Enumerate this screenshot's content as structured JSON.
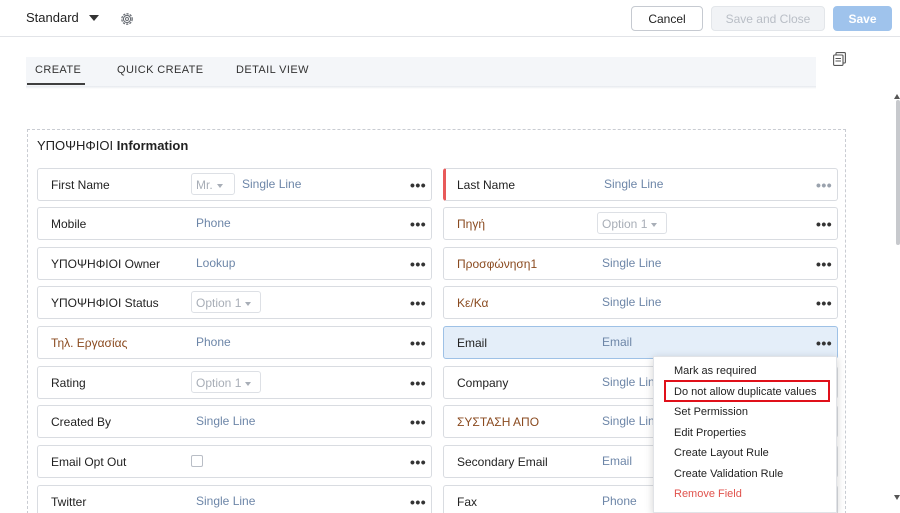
{
  "header": {
    "layout_name": "Standard",
    "cancel_label": "Cancel",
    "save_and_close_label": "Save and Close",
    "save_label": "Save"
  },
  "tabs": [
    {
      "label": "CREATE",
      "active": true
    },
    {
      "label": "QUICK CREATE",
      "active": false
    },
    {
      "label": "DETAIL VIEW",
      "active": false
    }
  ],
  "section": {
    "title_prefix": "ΥΠΟΨΗΦΙΟΙ",
    "title_suffix": "Information"
  },
  "fields_left": [
    {
      "label": "First Name",
      "type": "Single Line",
      "salutation": "Mr."
    },
    {
      "label": "Mobile",
      "type": "Phone"
    },
    {
      "label": "ΥΠΟΨΗΦΙΟΙ Owner",
      "type": "Lookup"
    },
    {
      "label": "ΥΠΟΨΗΦΙΟΙ Status",
      "type": "Option 1"
    },
    {
      "label": "Τηλ. Εργασίας",
      "type": "Phone"
    },
    {
      "label": "Rating",
      "type": "Option 1"
    },
    {
      "label": "Created By",
      "type": "Single Line"
    },
    {
      "label": "Email Opt Out",
      "type": ""
    },
    {
      "label": "Twitter",
      "type": "Single Line"
    }
  ],
  "fields_right": [
    {
      "label": "Last Name",
      "type": "Single Line"
    },
    {
      "label": "Πηγή",
      "type": "Option 1"
    },
    {
      "label": "Προσφώνηση1",
      "type": "Single Line"
    },
    {
      "label": "Κε/Κα",
      "type": "Single Line"
    },
    {
      "label": "Email",
      "type": "Email"
    },
    {
      "label": "Company",
      "type": "Single Line"
    },
    {
      "label": "ΣΥΣΤΑΣΗ ΑΠΟ",
      "type": "Single Line"
    },
    {
      "label": "Secondary Email",
      "type": "Email"
    },
    {
      "label": "Fax",
      "type": "Phone"
    }
  ],
  "more_symbol": "•••",
  "context_menu": {
    "items": [
      "Mark as required",
      "Do not allow duplicate values",
      "Set Permission",
      "Edit Properties",
      "Create Layout Rule",
      "Create Validation Rule",
      "Remove Field"
    ],
    "highlighted": "Do not allow duplicate values"
  },
  "colors": {
    "primary_disabled": "#9fc3ec",
    "mandatory": "#e85a5a",
    "custom_label": "#8a4a1f",
    "field_type": "#6d86a8",
    "danger": "#e0524c",
    "highlight_box": "#e0101a",
    "selected_field_bg": "#e4eef9"
  },
  "icons": {
    "settings": "gear-icon",
    "layout_preview": "layout-preview-icon",
    "dropdown": "caret-down-icon"
  }
}
